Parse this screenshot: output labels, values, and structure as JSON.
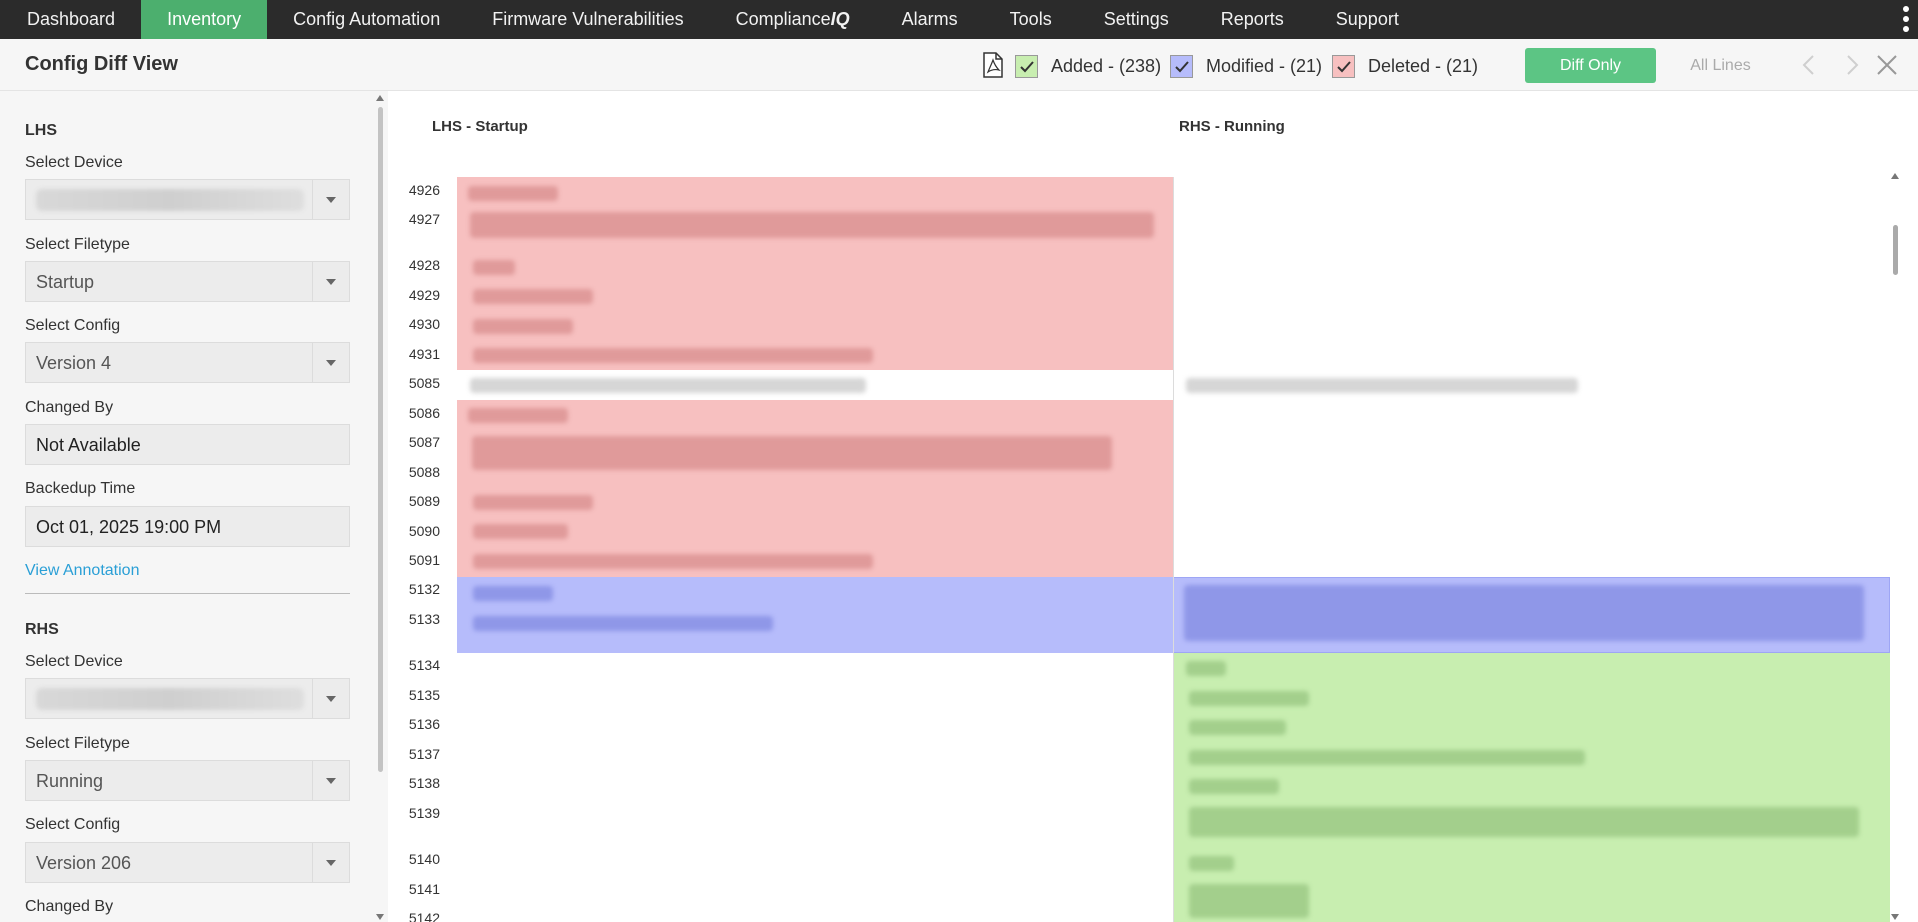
{
  "nav": {
    "items": [
      "Dashboard",
      "Inventory",
      "Config Automation",
      "Firmware Vulnerabilities",
      "Compliance",
      "Alarms",
      "Tools",
      "Settings",
      "Reports",
      "Support"
    ],
    "compliance_suffix": "IQ",
    "active": "Inventory"
  },
  "header": {
    "title": "Config Diff View",
    "added": "Added - (238)",
    "modified": "Modified - (21)",
    "deleted": "Deleted - (21)",
    "diff_only": "Diff Only",
    "all_lines": "All Lines"
  },
  "colors": {
    "added": "#c8eeb0",
    "modified": "#b6bcfb",
    "deleted": "#f7c0c0",
    "accent": "#4caf6e",
    "link": "#2a9fd6"
  },
  "lhs": {
    "title": "LHS",
    "select_device_label": "Select Device",
    "select_filetype_label": "Select Filetype",
    "filetype": "Startup",
    "select_config_label": "Select Config",
    "config": "Version 4",
    "changed_by_label": "Changed By",
    "changed_by": "Not Available",
    "backup_time_label": "Backedup Time",
    "backup_time": "Oct 01, 2025 19:00 PM",
    "view_annotation": "View Annotation"
  },
  "rhs": {
    "title": "RHS",
    "select_device_label": "Select Device",
    "select_filetype_label": "Select Filetype",
    "filetype": "Running",
    "select_config_label": "Select Config",
    "config": "Version 206",
    "changed_by_label": "Changed By"
  },
  "diff": {
    "lhs_header": "LHS - Startup",
    "rhs_header": "RHS - Running",
    "line_numbers": [
      "4926",
      "4927",
      "4928",
      "4929",
      "4930",
      "4931",
      "5085",
      "5086",
      "5087",
      "5088",
      "5089",
      "5090",
      "5091",
      "5132",
      "5133",
      "5134",
      "5135",
      "5136",
      "5137",
      "5138",
      "5139",
      "5140",
      "5141",
      "5142"
    ]
  }
}
